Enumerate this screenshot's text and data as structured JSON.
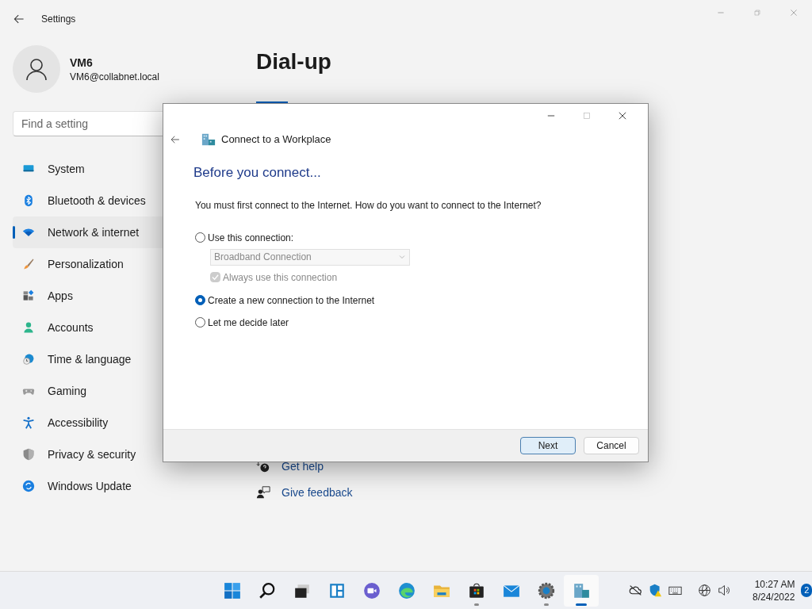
{
  "settings": {
    "title": "Settings",
    "user": {
      "name": "VM6",
      "email": "VM6@collabnet.local"
    },
    "search": {
      "placeholder": "Find a setting"
    },
    "nav": [
      {
        "label": "System",
        "selected": false
      },
      {
        "label": "Bluetooth & devices",
        "selected": false
      },
      {
        "label": "Network & internet",
        "selected": true
      },
      {
        "label": "Personalization",
        "selected": false
      },
      {
        "label": "Apps",
        "selected": false
      },
      {
        "label": "Accounts",
        "selected": false
      },
      {
        "label": "Time & language",
        "selected": false
      },
      {
        "label": "Gaming",
        "selected": false
      },
      {
        "label": "Accessibility",
        "selected": false
      },
      {
        "label": "Privacy & security",
        "selected": false
      },
      {
        "label": "Windows Update",
        "selected": false
      }
    ],
    "page_title": "Dial-up",
    "help_links": [
      "Get help",
      "Give feedback"
    ]
  },
  "dialog": {
    "title": "Connect to a Workplace",
    "heading": "Before you connect...",
    "prompt": "You must first connect to the Internet. How do you want to connect to the Internet?",
    "options": [
      {
        "kind": "radio",
        "label": "Use this connection:",
        "selected": false
      },
      {
        "kind": "dropdown",
        "value": "Broadband Connection",
        "disabled": true
      },
      {
        "kind": "checkbox",
        "label": "Always use this connection",
        "checked": true,
        "disabled": true
      },
      {
        "kind": "radio",
        "label": "Create a new connection to the Internet",
        "selected": true
      },
      {
        "kind": "radio",
        "label": "Let me decide later",
        "selected": false
      }
    ],
    "buttons": [
      {
        "label": "Next",
        "default": true
      },
      {
        "label": "Cancel",
        "default": false
      }
    ]
  },
  "taskbar": {
    "apps": [
      {
        "running": false,
        "active": false
      },
      {
        "running": false,
        "active": false
      },
      {
        "running": false,
        "active": false
      },
      {
        "running": false,
        "active": false
      },
      {
        "running": false,
        "active": false
      },
      {
        "running": false,
        "active": false
      },
      {
        "running": false,
        "active": false
      },
      {
        "running": true,
        "active": false
      },
      {
        "running": false,
        "active": false
      },
      {
        "running": true,
        "active": false
      },
      {
        "running": true,
        "active": true
      }
    ],
    "time": "10:27 AM",
    "date": "8/24/2022",
    "notifications": "2"
  }
}
